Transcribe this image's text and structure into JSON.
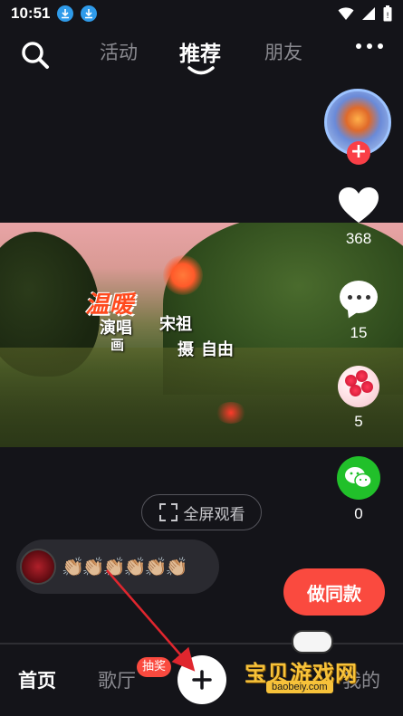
{
  "status_bar": {
    "time": "10:51",
    "icons": [
      "download-icon",
      "download-icon",
      "wifi-icon",
      "signal-icon",
      "battery-icon"
    ]
  },
  "top_nav": {
    "tabs": [
      {
        "label": "活动",
        "active": false
      },
      {
        "label": "推荐",
        "active": true
      },
      {
        "label": "朋友",
        "active": false
      }
    ]
  },
  "video": {
    "title": "温暖",
    "credit_line_1": "演唱",
    "credit_name_1": "宋祖",
    "credit_line_2": "摄",
    "credit_name_2": "自由",
    "credit_extra": "画"
  },
  "sidebar": {
    "likes": "368",
    "comments": "15",
    "gifts": "5",
    "shares": "0"
  },
  "fullscreen_label": "全屏观看",
  "comment_bar": {
    "emojis": "👏🏼👏🏼👏🏼👏🏼👏🏼👏🏼"
  },
  "make_same_label": "做同款",
  "bottom_nav": {
    "home": "首页",
    "hall": "歌厅",
    "lottery_badge": "抽奖",
    "mine": "我的"
  },
  "watermark": {
    "text": "宝贝游戏网",
    "url": "baobeiy.com"
  },
  "colors": {
    "accent_red": "#fa4a3f",
    "background": "#141419",
    "wechat_green": "#21c02a"
  }
}
